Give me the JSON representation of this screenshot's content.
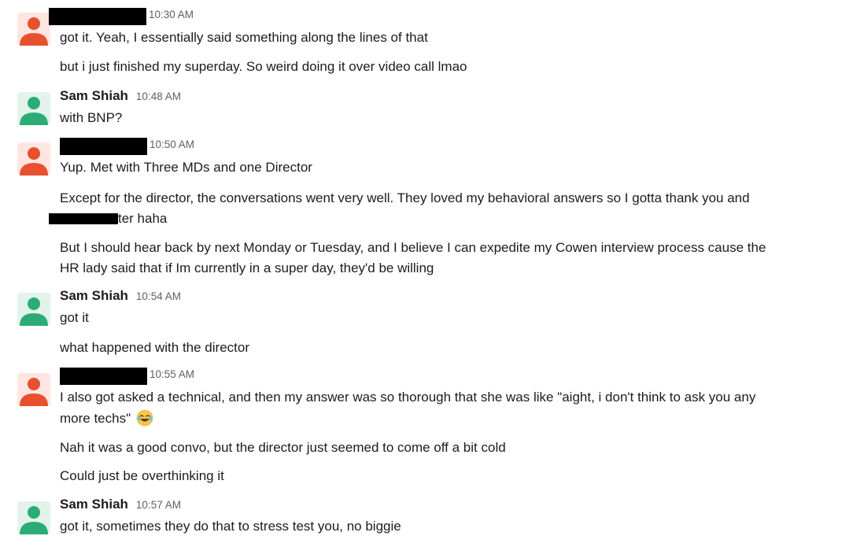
{
  "messages": [
    {
      "author": "",
      "author_redacted": true,
      "time": "10:30 AM",
      "avatar_color": "#e8502e",
      "lines": [
        "got it. Yeah, I essentially said something along the lines of that",
        "but i just finished my superday. So weird doing it over video call lmao"
      ]
    },
    {
      "author": "Sam Shiah",
      "author_redacted": false,
      "time": "10:48 AM",
      "avatar_color": "#2bac76",
      "lines": [
        "with BNP?"
      ]
    },
    {
      "author": "",
      "author_redacted": true,
      "time": "10:50 AM",
      "avatar_color": "#e8502e",
      "lines": [
        "Yup. Met with Three MDs and one Director",
        "Except for the director, the conversations went very well. They loved my behavioral answers so I gotta thank you and",
        "ter haha",
        "But I should hear back by next Monday or Tuesday, and I believe I can expedite my Cowen interview process cause the",
        "HR lady said that if Im currently in a super day, they'd be willing"
      ]
    },
    {
      "author": "Sam Shiah",
      "author_redacted": false,
      "time": "10:54 AM",
      "avatar_color": "#2bac76",
      "lines": [
        "got it",
        "what happened with the director"
      ]
    },
    {
      "author": "",
      "author_redacted": true,
      "time": "10:55 AM",
      "avatar_color": "#e8502e",
      "lines": [
        "I also got asked a technical, and then my answer was so thorough that she was like \"aight, i don't think to ask you any",
        "more techs\"",
        "Nah it was a good convo, but the director just seemed to come off a bit cold",
        "Could just be overthinking it"
      ],
      "emoji": "joy-emoji"
    },
    {
      "author": "Sam Shiah",
      "author_redacted": false,
      "time": "10:57 AM",
      "avatar_color": "#2bac76",
      "lines": [
        "got it, sometimes they do that to stress test you, no biggie"
      ]
    }
  ]
}
